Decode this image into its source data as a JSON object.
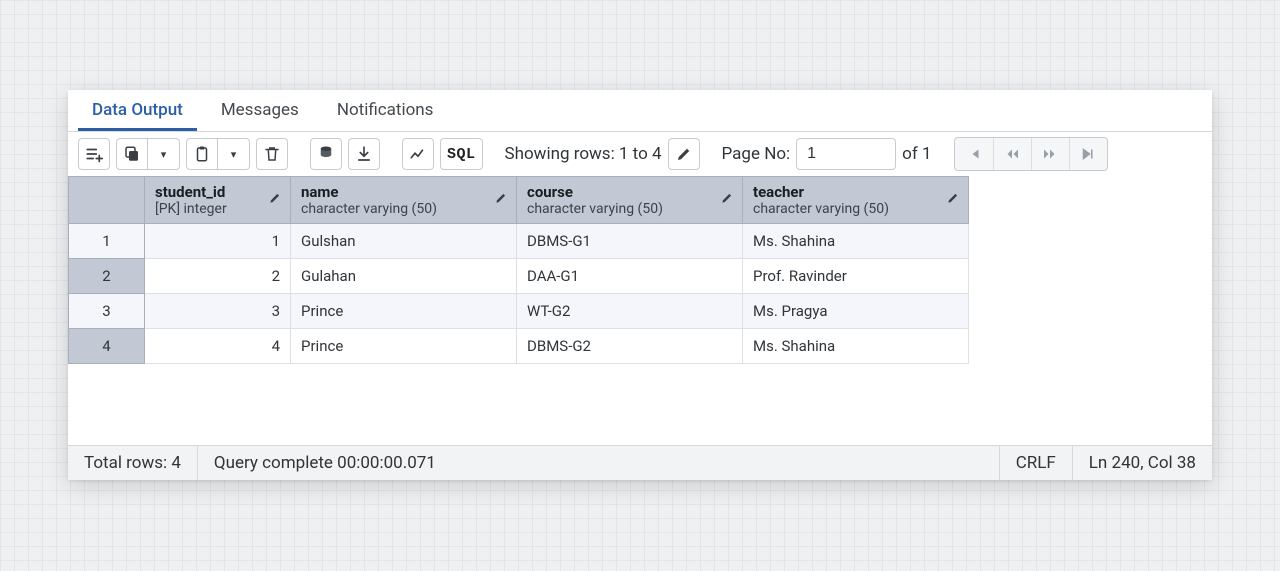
{
  "tabs": {
    "data_output": "Data Output",
    "messages": "Messages",
    "notifications": "Notifications"
  },
  "toolbar": {
    "sql_label": "SQL",
    "showing_rows": "Showing rows: 1 to 4",
    "page_label": "Page No:",
    "page_value": "1",
    "page_of": "of 1"
  },
  "columns": [
    {
      "name": "student_id",
      "type": "[PK] integer"
    },
    {
      "name": "name",
      "type": "character varying (50)"
    },
    {
      "name": "course",
      "type": "character varying (50)"
    },
    {
      "name": "teacher",
      "type": "character varying (50)"
    }
  ],
  "rows": [
    {
      "n": "1",
      "student_id": "1",
      "name": "Gulshan",
      "course": "DBMS-G1",
      "teacher": "Ms. Shahina"
    },
    {
      "n": "2",
      "student_id": "2",
      "name": "Gulahan",
      "course": "DAA-G1",
      "teacher": "Prof. Ravinder"
    },
    {
      "n": "3",
      "student_id": "3",
      "name": "Prince",
      "course": "WT-G2",
      "teacher": "Ms. Pragya"
    },
    {
      "n": "4",
      "student_id": "4",
      "name": "Prince",
      "course": "DBMS-G2",
      "teacher": "Ms. Shahina"
    }
  ],
  "status": {
    "total_rows": "Total rows: 4",
    "query_complete": "Query complete 00:00:00.071",
    "line_ending": "CRLF",
    "cursor": "Ln 240, Col 38"
  }
}
